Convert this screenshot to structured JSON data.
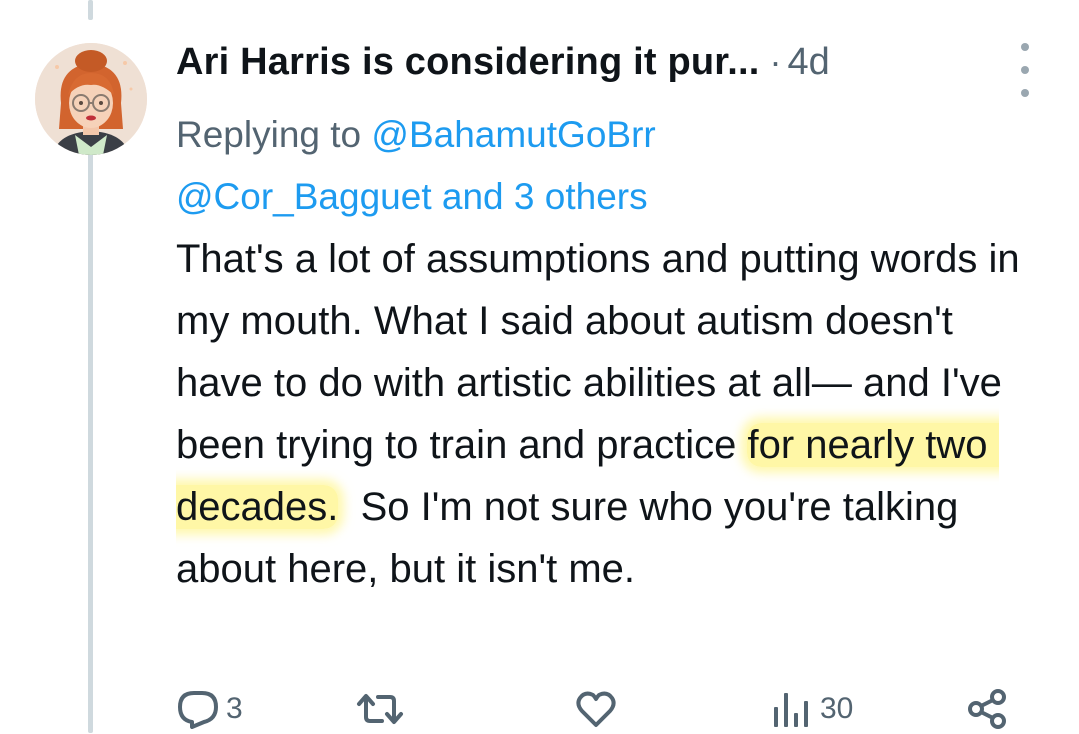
{
  "tweet": {
    "author_name": "Ari Harris is considering it pur...",
    "separator": "·",
    "time": "4d",
    "reply_prefix": "Replying to ",
    "mention_1": "@BahamutGoBrr",
    "mention_2": "@Cor_Bagguet",
    "reply_suffix": " and 3 others",
    "text_before": "That's a lot of assumptions and putting words in my mouth. What I said about autism doesn't have to do with artistic abilities at all— and I've been trying to train and practice ",
    "text_highlighted": "for nearly two decades.",
    "text_after": "  So I'm not sure who you're talking about here, but it isn't me.",
    "highlight_color": "#fff696"
  },
  "actions": {
    "reply_count": "3",
    "retweet_count": "",
    "like_count": "",
    "views_count": "30"
  },
  "icons": {
    "avatar": "avatar-image",
    "more": "more-dots-icon",
    "reply": "reply-icon",
    "retweet": "retweet-icon",
    "like": "heart-icon",
    "views": "views-icon",
    "share": "share-icon"
  },
  "colors": {
    "text": "#0f1419",
    "secondary": "#536471",
    "link": "#1d9bf0",
    "thread_line": "#cfd9de"
  }
}
